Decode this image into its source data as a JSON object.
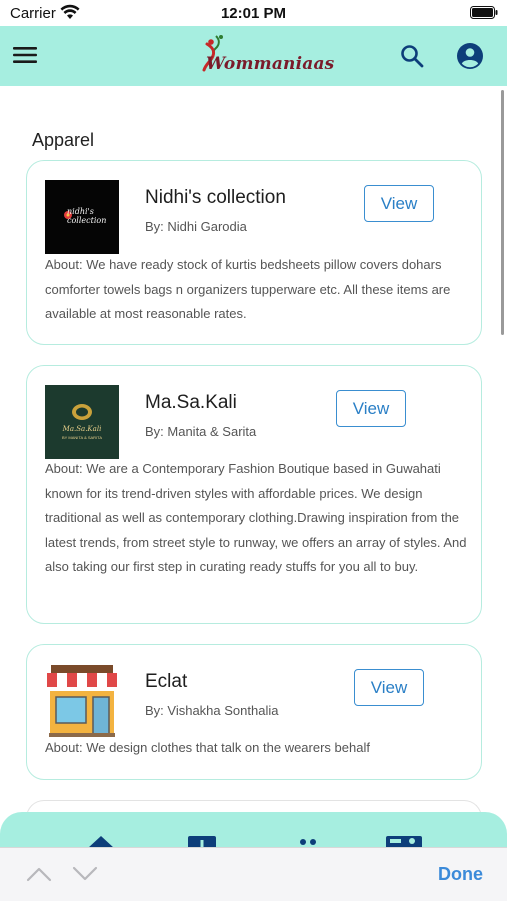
{
  "status_bar": {
    "carrier": "Carrier",
    "time": "12:01 PM"
  },
  "header": {
    "logo_text": "Wommaniaas",
    "brand_color": "#a6eee0",
    "icons": [
      "menu-icon",
      "search-icon",
      "account-circle-icon"
    ]
  },
  "section": {
    "title": "Apparel"
  },
  "cards": [
    {
      "thumb_text": "nidhi's collection",
      "name": "Nidhi's collection",
      "by": "By: Nidhi Garodia",
      "view_label": "View",
      "about": "About: We have ready stock of kurtis bedsheets pillow covers dohars comforter towels bags n organizers tupperware etc. All these items are available at most reasonable rates."
    },
    {
      "thumb_text": "Ma.Sa.Kali",
      "thumb_subtext": "BY MANITA & SARITA",
      "name": "Ma.Sa.Kali",
      "by": "By: Manita & Sarita",
      "view_label": "View",
      "about": "About: We are a Contemporary Fashion Boutique based in Guwahati known for its trend-driven styles with affordable prices. We design traditional as well as contemporary clothing.Drawing inspiration from the latest trends, from street style to runway, we offers an array of styles. And also taking our first step in curating ready stuffs for you all to buy."
    },
    {
      "name": "Eclat",
      "by": "By: Vishakha Sonthalia",
      "view_label": "View",
      "about": "About: We design clothes that talk on the wearers behalf"
    }
  ],
  "bottom_nav": {
    "icons": [
      "home-icon",
      "add-box-icon",
      "people-icon",
      "contact-mail-icon"
    ]
  },
  "keyboard_toolbar": {
    "done_label": "Done"
  },
  "colors": {
    "accent": "#3a8ed0",
    "card_border": "#b6ecdf",
    "done": "#3b8ad9"
  }
}
